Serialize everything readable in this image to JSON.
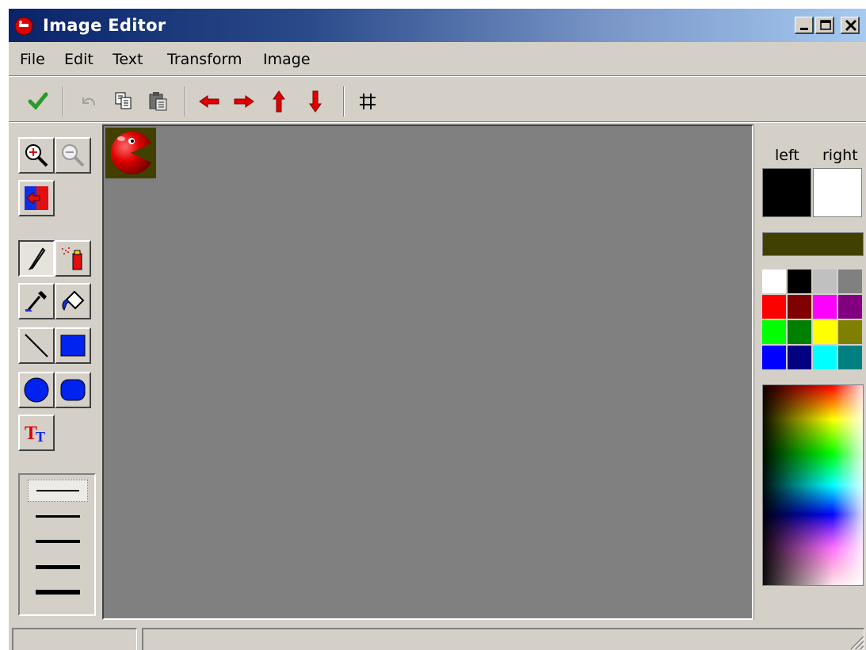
{
  "window": {
    "title": "Image Editor",
    "icon": "app-icon"
  },
  "caption_buttons": [
    {
      "name": "minimize-button",
      "icon": "minimize-icon"
    },
    {
      "name": "maximize-button",
      "icon": "maximize-icon"
    },
    {
      "name": "close-button",
      "icon": "close-icon"
    }
  ],
  "menu": {
    "file": "File",
    "edit": "Edit",
    "text": "Text",
    "transform": "Transform",
    "image": "Image"
  },
  "toolbar": {
    "items": [
      "check-icon",
      "undo-icon",
      "copy-icon",
      "paste-icon",
      "arrow-left-icon",
      "arrow-right-icon",
      "arrow-up-icon",
      "arrow-down-icon",
      "grid-icon"
    ]
  },
  "tools": [
    "zoom-in",
    "zoom-out",
    "resize",
    "pencil",
    "spray-can",
    "eyedropper",
    "fill-bucket",
    "line",
    "rectangle",
    "ellipse",
    "rounded-rectangle",
    "text"
  ],
  "tool_text_glyph": {
    "big": "T",
    "small": "T"
  },
  "line_widths": {
    "selected": 1,
    "options": [
      1,
      2,
      3,
      4,
      5
    ]
  },
  "color_panel": {
    "left_label": "left",
    "right_label": "right",
    "left_color": "#000000",
    "right_color": "#ffffff",
    "current_color": "#404000",
    "palette": [
      "#ffffff",
      "#000000",
      "#c0c0c0",
      "#808080",
      "#ff0000",
      "#800000",
      "#ff00ff",
      "#800080",
      "#00ff00",
      "#008000",
      "#ffff00",
      "#808000",
      "#0000ff",
      "#000080",
      "#00ffff",
      "#008080"
    ]
  },
  "status": {
    "pane1": "",
    "pane2": ""
  }
}
